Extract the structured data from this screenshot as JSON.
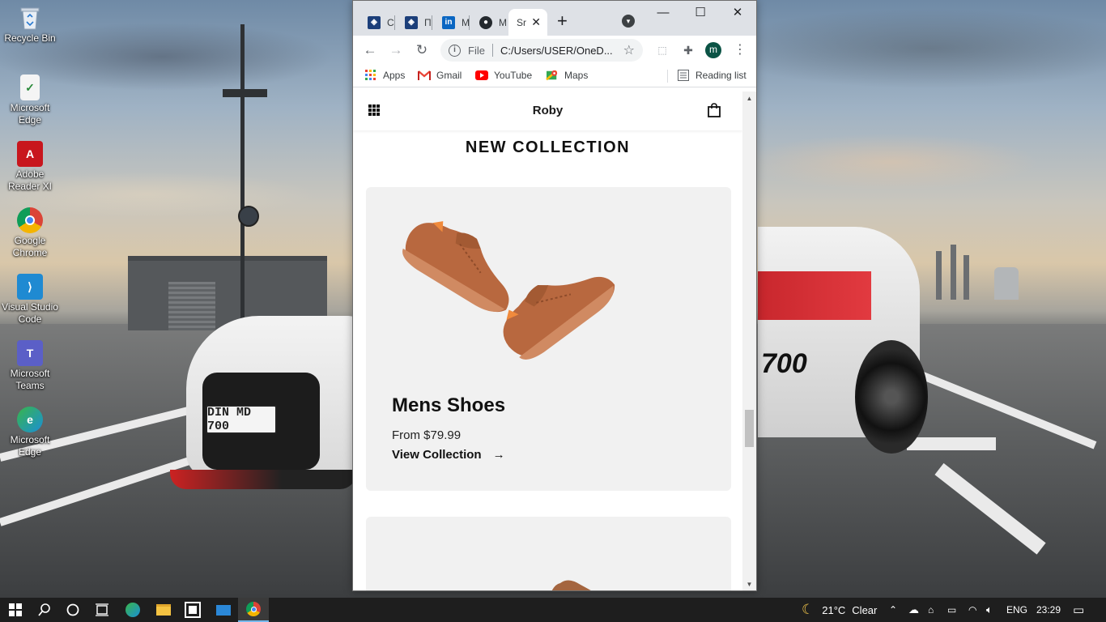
{
  "desktop": {
    "icons": [
      {
        "label": "Recycle Bin",
        "icon": "recycle-bin-icon"
      },
      {
        "label": "Microsoft Edge",
        "icon": "edge-legacy-icon"
      },
      {
        "label": "Adobe Reader XI",
        "icon": "adobe-reader-icon"
      },
      {
        "label": "Google Chrome",
        "icon": "chrome-icon"
      },
      {
        "label": "Visual Studio Code",
        "icon": "vscode-icon"
      },
      {
        "label": "Microsoft Teams",
        "icon": "teams-icon"
      },
      {
        "label": "Microsoft Edge",
        "icon": "edge-icon"
      }
    ],
    "wallpaper": {
      "plate_text": "DIN MD 700",
      "car_badge": "700"
    }
  },
  "browser": {
    "tabs": [
      {
        "title": "C",
        "icon": "site-shield-icon"
      },
      {
        "title": "Π",
        "icon": "site-shield-icon"
      },
      {
        "title": "M",
        "icon": "linkedin-icon"
      },
      {
        "title": "M",
        "icon": "github-icon"
      },
      {
        "title": "Sr",
        "icon": "page-icon",
        "active": true
      }
    ],
    "window_controls": {
      "minimize": "—",
      "maximize": "☐",
      "close": "✕"
    },
    "address": {
      "scheme": "File",
      "url": "C:/Users/USER/OneD..."
    },
    "profile_initial": "m",
    "bookmarks": [
      {
        "label": "Apps",
        "icon": "apps-grid-icon"
      },
      {
        "label": "Gmail",
        "icon": "gmail-icon"
      },
      {
        "label": "YouTube",
        "icon": "youtube-icon"
      },
      {
        "label": "Maps",
        "icon": "maps-icon"
      }
    ],
    "reading_list": "Reading list"
  },
  "site": {
    "logo": "Roby",
    "section_title": "NEW COLLECTION",
    "cards": [
      {
        "title": "Mens Shoes",
        "price": "From $79.99",
        "link": "View Collection"
      }
    ]
  },
  "taskbar": {
    "weather": "21°C",
    "condition": "Clear",
    "language": "ENG",
    "time": "23:29"
  },
  "colors": {
    "accent_tab_bg": "#dee1e6",
    "card_bg": "#f1f1f1",
    "shoe_color": "#b86d45",
    "taskbar": "#1e1e1e"
  }
}
